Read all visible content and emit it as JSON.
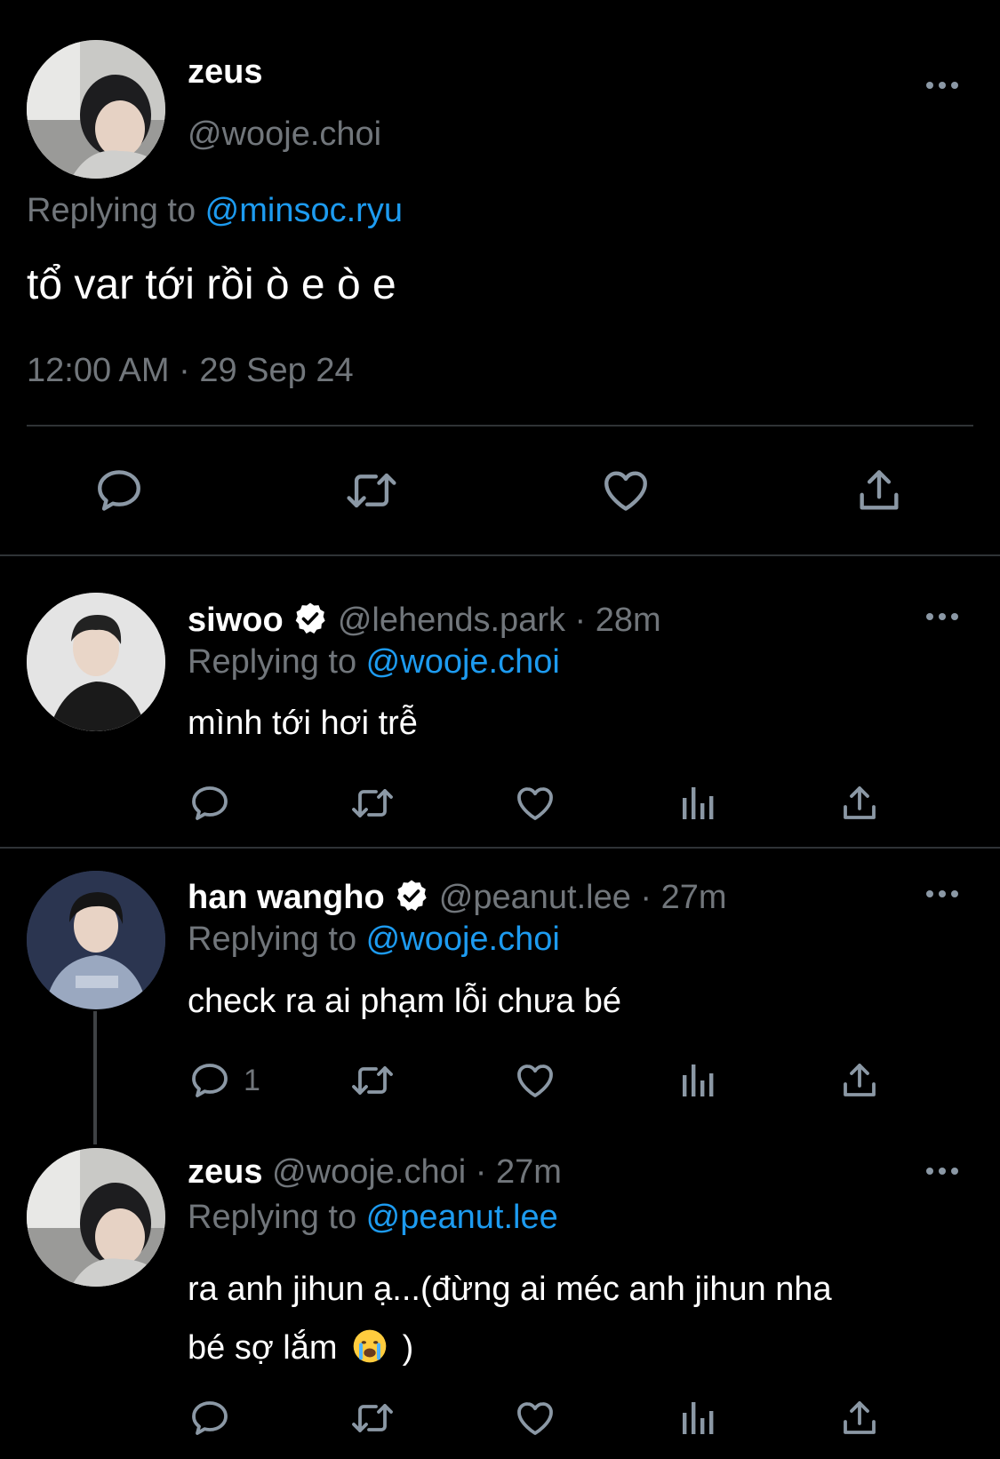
{
  "colors": {
    "background": "#000000",
    "text": "#e7e9ea",
    "secondary": "#71767b",
    "link": "#1d9bf0",
    "divider": "#2f3336",
    "icon": "#8b98a5"
  },
  "main_tweet": {
    "name": "zeus",
    "handle": "@wooje.choi",
    "replying_prefix": "Replying to ",
    "replying_handle": "@minsoc.ryu",
    "text": "tổ var tới rồi ò e ò e",
    "timestamp": "12:00 AM · 29 Sep 24",
    "actions": [
      "comment-icon",
      "retweet-icon",
      "heart-icon",
      "share-icon"
    ]
  },
  "replies": [
    {
      "name": "siwoo",
      "verified": true,
      "meta": "@lehends.park · 28m",
      "replying_prefix": "Replying to ",
      "replying_handle": "@wooje.choi",
      "text": "mình tới hơi trễ",
      "comment_count": ""
    },
    {
      "name": "han wangho",
      "verified": true,
      "meta": "@peanut.lee · 27m",
      "replying_prefix": "Replying to ",
      "replying_handle": "@wooje.choi",
      "text": "check ra ai phạm lỗi chưa bé",
      "comment_count": "1"
    },
    {
      "name": "zeus",
      "verified": false,
      "meta": "@wooje.choi · 27m",
      "replying_prefix": "Replying to ",
      "replying_handle": "@peanut.lee",
      "text_line1": "ra anh jihun ạ...(đừng ai méc anh jihun nha",
      "text_line2": "bé sợ lắm",
      "text_line2_end": ")",
      "comment_count": ""
    }
  ]
}
